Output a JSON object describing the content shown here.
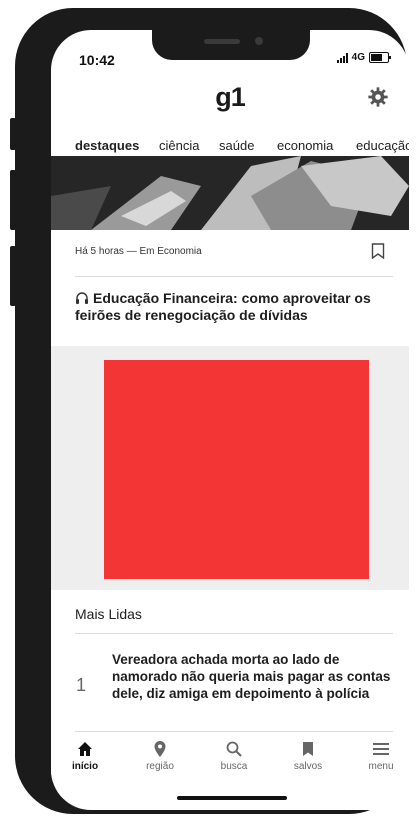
{
  "status": {
    "time": "10:42",
    "network": "4G"
  },
  "header": {
    "logo": "g1"
  },
  "tabs": [
    {
      "label": "destaques"
    },
    {
      "label": "ciência"
    },
    {
      "label": "saúde"
    },
    {
      "label": "economia"
    },
    {
      "label": "educação"
    }
  ],
  "article": {
    "meta": "Há 5 horas — Em Economia",
    "headline": "Educação Financeira: como aproveitar os feirões de renegociação de dívidas"
  },
  "ad": {
    "color": "#f33535"
  },
  "most_read": {
    "title": "Mais Lidas",
    "items": [
      {
        "rank": "1",
        "text": "Vereadora achada morta ao lado de namorado não queria mais pagar as contas dele, diz amiga em depoimento à polícia"
      }
    ]
  },
  "bottom_nav": [
    {
      "label": "início",
      "icon": "home-icon"
    },
    {
      "label": "região",
      "icon": "location-pin-icon"
    },
    {
      "label": "busca",
      "icon": "search-icon"
    },
    {
      "label": "salvos",
      "icon": "bookmark-icon"
    },
    {
      "label": "menu",
      "icon": "menu-icon"
    }
  ]
}
